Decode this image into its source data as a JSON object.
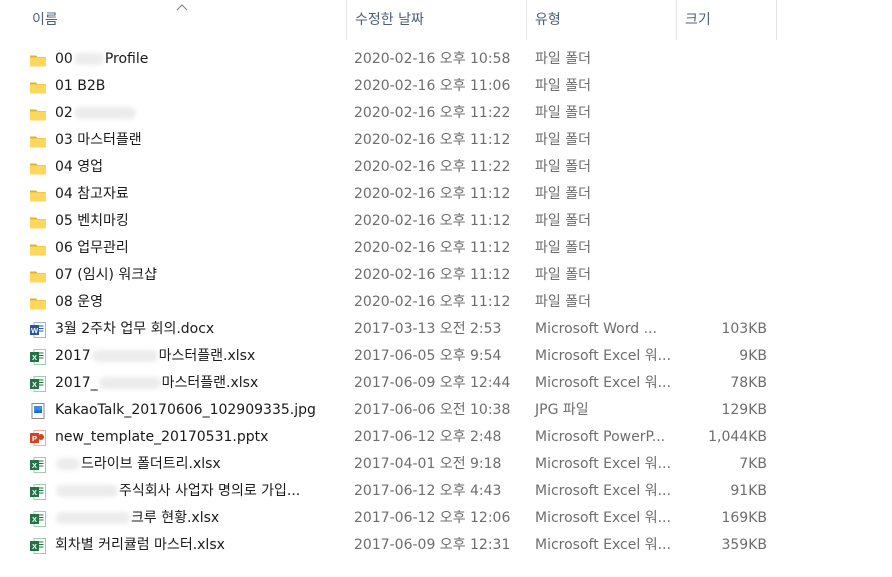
{
  "header": {
    "name": "이름",
    "date": "수정한 날짜",
    "type": "유형",
    "size": "크기"
  },
  "rows": [
    {
      "icon": "folder-icon",
      "name_pre": "00",
      "name_post": "Profile",
      "blur": 30,
      "date": "2020-02-16 오후 10:58",
      "type": "파일 폴더",
      "size": ""
    },
    {
      "icon": "folder-icon",
      "name_pre": "01 B2B",
      "name_post": "",
      "blur": 0,
      "date": "2020-02-16 오후 11:06",
      "type": "파일 폴더",
      "size": ""
    },
    {
      "icon": "folder-icon",
      "name_pre": "02",
      "name_post": "",
      "blur": 62,
      "date": "2020-02-16 오후 11:22",
      "type": "파일 폴더",
      "size": ""
    },
    {
      "icon": "folder-icon",
      "name_pre": "03 마스터플랜",
      "name_post": "",
      "blur": 0,
      "date": "2020-02-16 오후 11:12",
      "type": "파일 폴더",
      "size": ""
    },
    {
      "icon": "folder-icon",
      "name_pre": "04 영업",
      "name_post": "",
      "blur": 0,
      "date": "2020-02-16 오후 11:22",
      "type": "파일 폴더",
      "size": ""
    },
    {
      "icon": "folder-icon",
      "name_pre": "04 참고자료",
      "name_post": "",
      "blur": 0,
      "date": "2020-02-16 오후 11:12",
      "type": "파일 폴더",
      "size": ""
    },
    {
      "icon": "folder-icon",
      "name_pre": "05 벤치마킹",
      "name_post": "",
      "blur": 0,
      "date": "2020-02-16 오후 11:12",
      "type": "파일 폴더",
      "size": ""
    },
    {
      "icon": "folder-icon",
      "name_pre": "06 업무관리",
      "name_post": "",
      "blur": 0,
      "date": "2020-02-16 오후 11:12",
      "type": "파일 폴더",
      "size": ""
    },
    {
      "icon": "folder-icon",
      "name_pre": "07 (임시) 워크샵",
      "name_post": "",
      "blur": 0,
      "date": "2020-02-16 오후 11:12",
      "type": "파일 폴더",
      "size": ""
    },
    {
      "icon": "folder-icon",
      "name_pre": "08 운영",
      "name_post": "",
      "blur": 0,
      "date": "2020-02-16 오후 11:12",
      "type": "파일 폴더",
      "size": ""
    },
    {
      "icon": "word-icon",
      "name_pre": "3월 2주차 업무 회의.docx",
      "name_post": "",
      "blur": 0,
      "date": "2017-03-13 오전 2:53",
      "type": "Microsoft Word ...",
      "size": "103KB"
    },
    {
      "icon": "excel-icon",
      "name_pre": "2017",
      "name_post": "마스터플랜.xlsx",
      "blur": 66,
      "date": "2017-06-05 오후 9:54",
      "type": "Microsoft Excel 워...",
      "size": "9KB"
    },
    {
      "icon": "excel-icon",
      "name_pre": "2017_",
      "name_post": "마스터플랜.xlsx",
      "blur": 62,
      "date": "2017-06-09 오후 12:44",
      "type": "Microsoft Excel 워...",
      "size": "78KB"
    },
    {
      "icon": "jpg-icon",
      "name_pre": "KakaoTalk_20170606_102909335.jpg",
      "name_post": "",
      "blur": 0,
      "date": "2017-06-06 오전 10:38",
      "type": "JPG 파일",
      "size": "129KB"
    },
    {
      "icon": "powerpoint-icon",
      "name_pre": "new_template_20170531.pptx",
      "name_post": "",
      "blur": 0,
      "date": "2017-06-12 오후 2:48",
      "type": "Microsoft PowerP...",
      "size": "1,044KB"
    },
    {
      "icon": "excel-icon",
      "name_pre": "",
      "name_post": "드라이브 폴더트리.xlsx",
      "blur": 24,
      "date": "2017-04-01 오전 9:18",
      "type": "Microsoft Excel 워...",
      "size": "7KB"
    },
    {
      "icon": "excel-icon",
      "name_pre": "",
      "name_post": "주식회사 사업자 명의로 가입...",
      "blur": 62,
      "date": "2017-06-12 오후 4:43",
      "type": "Microsoft Excel 워...",
      "size": "91KB"
    },
    {
      "icon": "excel-icon",
      "name_pre": "",
      "name_post": "크루 현황.xlsx",
      "blur": 74,
      "date": "2017-06-12 오후 12:06",
      "type": "Microsoft Excel 워...",
      "size": "169KB"
    },
    {
      "icon": "excel-icon",
      "name_pre": "회차별 커리큘럼 마스터.xlsx",
      "name_post": "",
      "blur": 0,
      "date": "2017-06-09 오후 12:31",
      "type": "Microsoft Excel 워...",
      "size": "359KB"
    }
  ]
}
